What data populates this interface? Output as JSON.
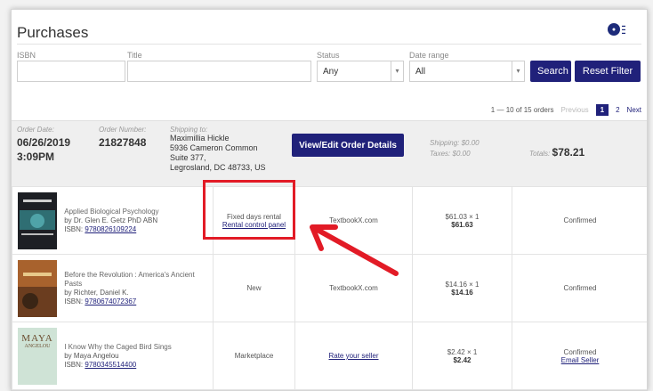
{
  "page": {
    "title": "Purchases"
  },
  "filters": {
    "isbn_label": "ISBN",
    "title_label": "Title",
    "status_label": "Status",
    "status_value": "Any",
    "date_label": "Date range",
    "date_value": "All",
    "search_label": "Search",
    "reset_label": "Reset Filter"
  },
  "pagination": {
    "summary": "1 — 10 of 15 orders",
    "previous": "Previous",
    "pages": [
      "1",
      "2"
    ],
    "next": "Next"
  },
  "order": {
    "date_label": "Order Date:",
    "date": "06/26/2019",
    "time": "3:09PM",
    "number_label": "Order Number:",
    "number": "21827848",
    "ship_label": "Shipping to:",
    "ship_name": "Maximillia Hickle",
    "ship_line1": "5936 Cameron Common",
    "ship_line2": "Suite 377,",
    "ship_line3": "Legrosland, DC 48733, US",
    "details_button": "View/Edit Order Details",
    "shipping": "Shipping: $0.00",
    "taxes": "Taxes: $0.00",
    "totals_label": "Totals:",
    "totals": "$78.21"
  },
  "items": [
    {
      "title": "Applied Biological Psychology",
      "author": "by Dr. Glen E. Getz PhD ABN",
      "isbn_label": "ISBN:",
      "isbn": "9780826109224",
      "condition": "Fixed days rental",
      "condition_link": "Rental control panel",
      "seller": "TextbookX.com",
      "price_each": "$61.03 × 1",
      "price": "$61.63",
      "status": "Confirmed",
      "status_link": ""
    },
    {
      "title": "Before the Revolution : America's Ancient Pasts",
      "author": "by Richter, Daniel K.",
      "isbn_label": "ISBN:",
      "isbn": "9780674072367",
      "condition": "New",
      "condition_link": "",
      "seller": "TextbookX.com",
      "price_each": "$14.16 × 1",
      "price": "$14.16",
      "status": "Confirmed",
      "status_link": ""
    },
    {
      "title": "I Know Why the Caged Bird Sings",
      "author": "by Maya Angelou",
      "isbn_label": "ISBN:",
      "isbn": "9780345514400",
      "condition": "Marketplace",
      "condition_link": "",
      "seller": "Rate your seller",
      "price_each": "$2.42 × 1",
      "price": "$2.42",
      "status": "Confirmed",
      "status_link": "Email Seller",
      "cover_text_1": "MAYA",
      "cover_text_2": "ANGELOU"
    }
  ],
  "colors": {
    "accent": "#20217a",
    "highlight": "#e21b26"
  }
}
